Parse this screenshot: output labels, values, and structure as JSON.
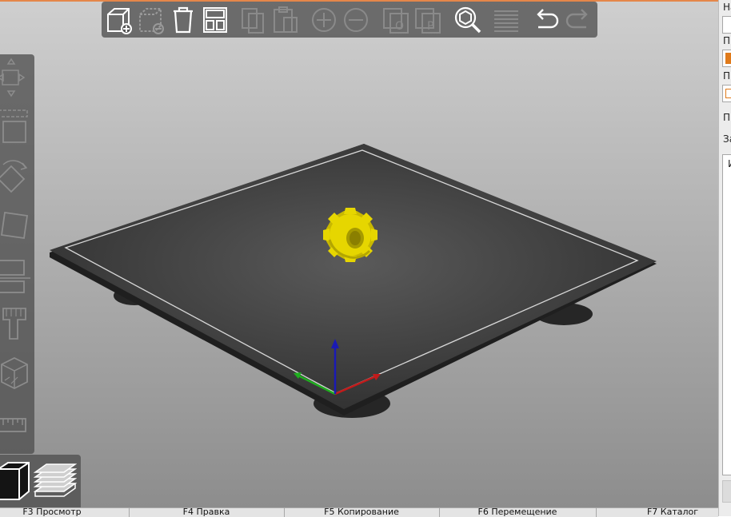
{
  "toolbar": {
    "buttons": [
      {
        "icon": "add-object-icon",
        "enabled": true
      },
      {
        "icon": "remove-object-icon",
        "enabled": false
      },
      {
        "icon": "delete-all-icon",
        "enabled": true
      },
      {
        "icon": "arrange-icon",
        "enabled": true
      },
      {
        "icon": "copy-icon",
        "enabled": false
      },
      {
        "icon": "paste-icon",
        "enabled": false
      },
      {
        "icon": "add-instance-icon",
        "enabled": false
      },
      {
        "icon": "remove-instance-icon",
        "enabled": false
      },
      {
        "icon": "split-objects-icon",
        "enabled": false
      },
      {
        "icon": "split-parts-icon",
        "enabled": false
      },
      {
        "icon": "search-icon",
        "enabled": true
      },
      {
        "icon": "layers-editing-icon",
        "enabled": false
      },
      {
        "icon": "undo-icon",
        "enabled": true
      },
      {
        "icon": "redo-icon",
        "enabled": false
      }
    ]
  },
  "left_toolbar": {
    "tools": [
      "move-icon",
      "scale-icon",
      "rotate-icon",
      "place-on-face-icon",
      "cut-icon",
      "paint-supports-icon",
      "seam-painting-icon",
      "measure-icon"
    ]
  },
  "view_toolbar": {
    "buttons": [
      "3d-view-icon",
      "preview-layers-icon"
    ]
  },
  "right_panel": {
    "labels": [
      "На",
      "Пр",
      "Пр",
      "П",
      "За",
      "И"
    ],
    "accent_color": "#e07a1a"
  },
  "status_bar": {
    "items": [
      "F3 Просмотр",
      "F4 Правка",
      "F5 Копирование",
      "F6 Перемещение",
      "F7 Каталог"
    ]
  },
  "scene": {
    "bed_color": "#3a3a3a",
    "object_color": "#e6d600",
    "axis_colors": {
      "x": "#c21a1a",
      "y": "#1fae1f",
      "z": "#1a1ab4"
    }
  }
}
